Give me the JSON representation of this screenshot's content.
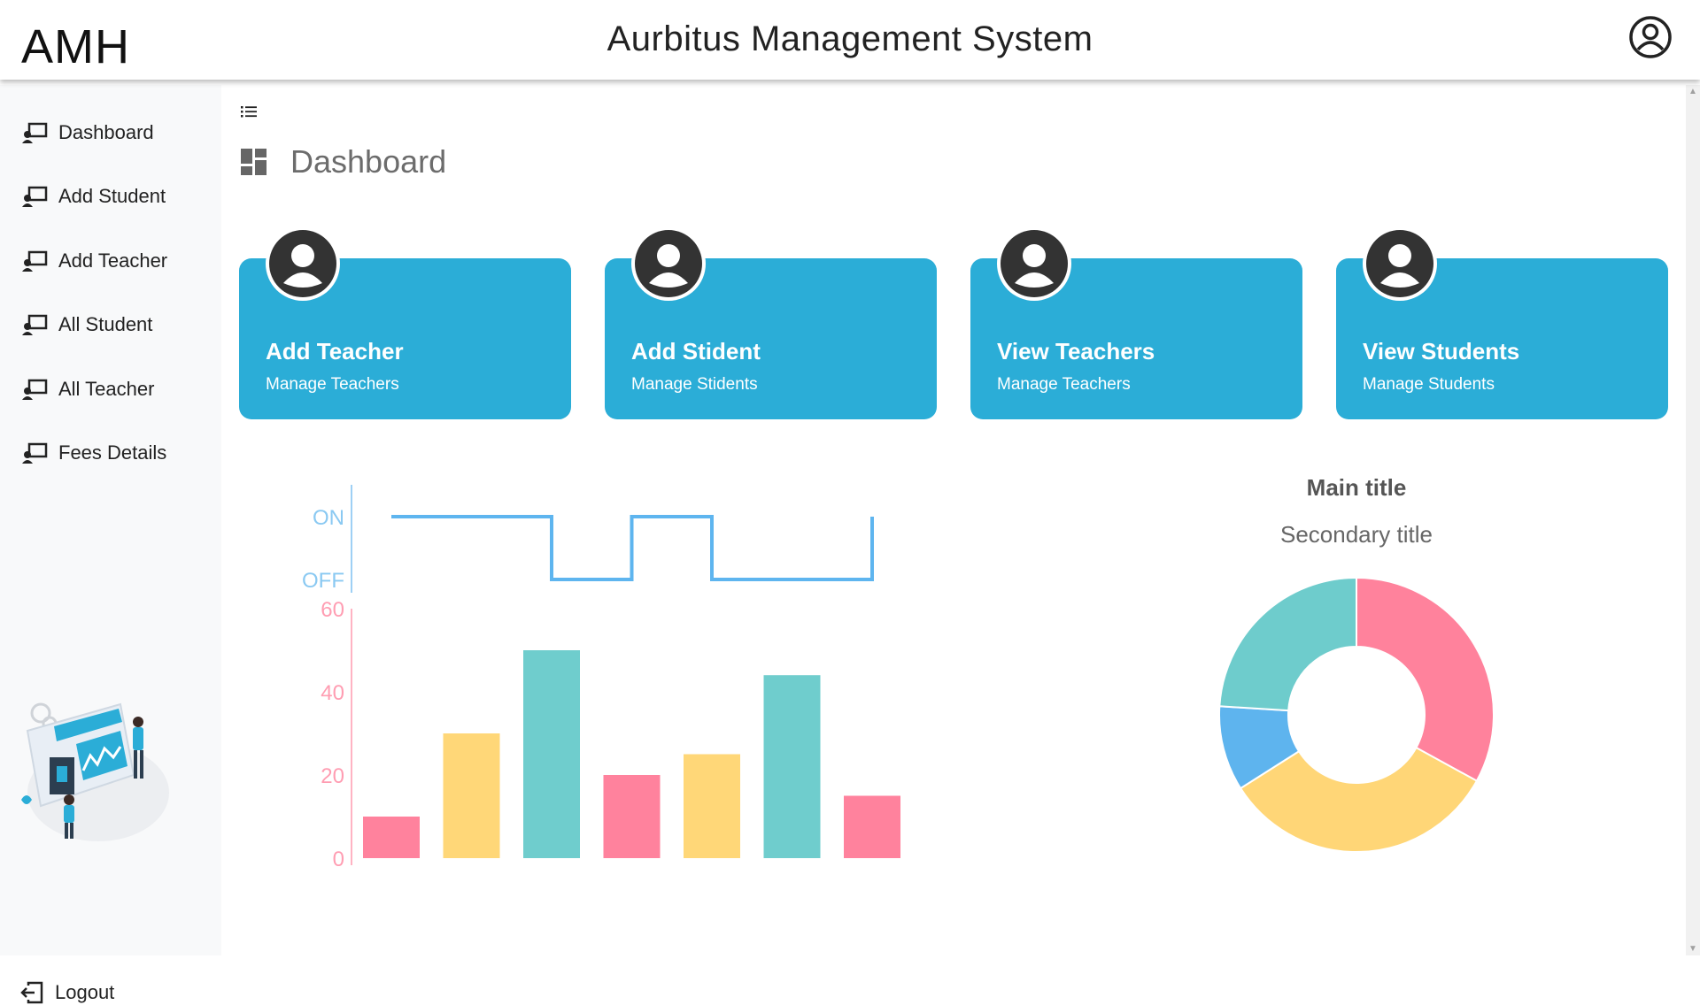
{
  "header": {
    "logo": "AMH",
    "title": "Aurbitus Management System",
    "user_icon": "user-circle-icon"
  },
  "sidebar": {
    "items": [
      {
        "label": "Dashboard",
        "icon": "teacher-board-icon"
      },
      {
        "label": "Add Student",
        "icon": "teacher-board-icon"
      },
      {
        "label": "Add Teacher",
        "icon": "teacher-board-icon"
      },
      {
        "label": "All Student",
        "icon": "teacher-board-icon"
      },
      {
        "label": "All Teacher",
        "icon": "teacher-board-icon"
      },
      {
        "label": "Fees Details",
        "icon": "teacher-board-icon"
      }
    ],
    "logout_label": "Logout",
    "logout_icon": "logout-icon"
  },
  "main": {
    "page_title": "Dashboard",
    "menu_icon": "list-icon",
    "cards": [
      {
        "title": "Add Teacher",
        "subtitle": "Manage Teachers"
      },
      {
        "title": "Add Stident",
        "subtitle": "Manage Stidents"
      },
      {
        "title": "View Teachers",
        "subtitle": "Manage Teachers"
      },
      {
        "title": "View Students",
        "subtitle": "Manage Students"
      }
    ]
  },
  "colors": {
    "card": "#2badd7",
    "pink": "#ff6384",
    "yellow": "#ffcd56",
    "teal": "#4bc0c0",
    "blue": "#36a2eb"
  },
  "chart_data": [
    {
      "type": "line",
      "step": true,
      "y_categories": [
        "OFF",
        "ON"
      ],
      "values": [
        "ON",
        "ON",
        "OFF",
        "ON",
        "OFF",
        "OFF",
        "ON"
      ],
      "color": "#36a2eb"
    },
    {
      "type": "bar",
      "values": [
        10,
        30,
        50,
        20,
        25,
        44,
        15
      ],
      "colors": [
        "#ff6384",
        "#ffcd56",
        "#4bc0c0",
        "#ff6384",
        "#ffcd56",
        "#4bc0c0",
        "#ff6384"
      ],
      "yticks": [
        "0",
        "20",
        "40",
        "60"
      ],
      "ylim": [
        0,
        60
      ]
    },
    {
      "type": "pie",
      "donut": true,
      "title": "Main title",
      "subtitle": "Secondary title",
      "values": [
        33,
        33,
        10,
        24
      ],
      "colors": [
        "#ff6384",
        "#ffcd56",
        "#36a2eb",
        "#4bc0c0"
      ]
    }
  ]
}
